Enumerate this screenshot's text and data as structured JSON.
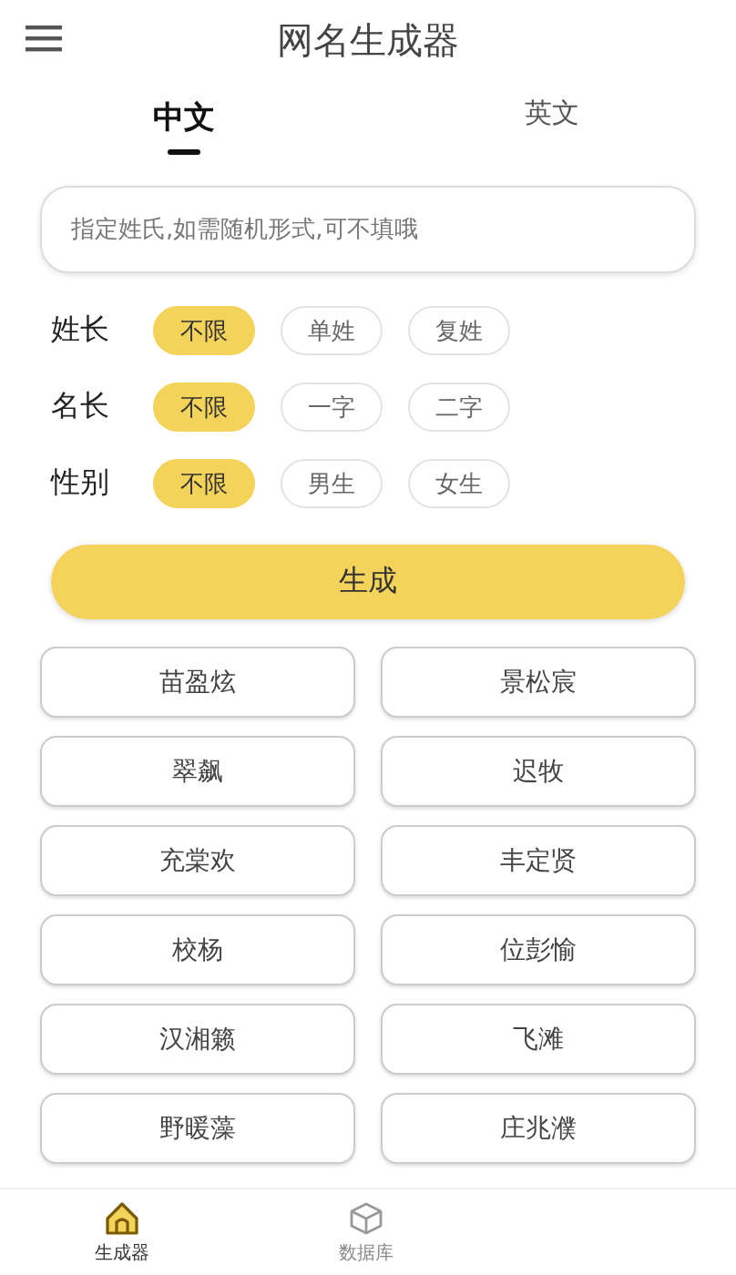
{
  "title": "网名生成器",
  "tabs": [
    {
      "label": "中文",
      "selected": true
    },
    {
      "label": "英文",
      "selected": false
    }
  ],
  "search": {
    "placeholder": "指定姓氏,如需随机形式,可不填哦"
  },
  "options": [
    {
      "label": "姓长",
      "choices": [
        {
          "label": "不限",
          "selected": true
        },
        {
          "label": "单姓",
          "selected": false
        },
        {
          "label": "复姓",
          "selected": false
        }
      ]
    },
    {
      "label": "名长",
      "choices": [
        {
          "label": "不限",
          "selected": true
        },
        {
          "label": "一字",
          "selected": false
        },
        {
          "label": "二字",
          "selected": false
        }
      ]
    },
    {
      "label": "性别",
      "choices": [
        {
          "label": "不限",
          "selected": true
        },
        {
          "label": "男生",
          "selected": false
        },
        {
          "label": "女生",
          "selected": false
        }
      ]
    }
  ],
  "generate_button": "生成",
  "names": [
    "苗盈炫",
    "景松宸",
    "翠飙",
    "迟牧",
    "充棠欢",
    "丰定贤",
    "校杨",
    "位彭愉",
    "汉湘籁",
    "飞滩",
    "野暖藻",
    "庄兆濮"
  ],
  "bottom_nav": [
    {
      "label": "生成器",
      "selected": true
    },
    {
      "label": "数据库",
      "selected": false
    }
  ]
}
